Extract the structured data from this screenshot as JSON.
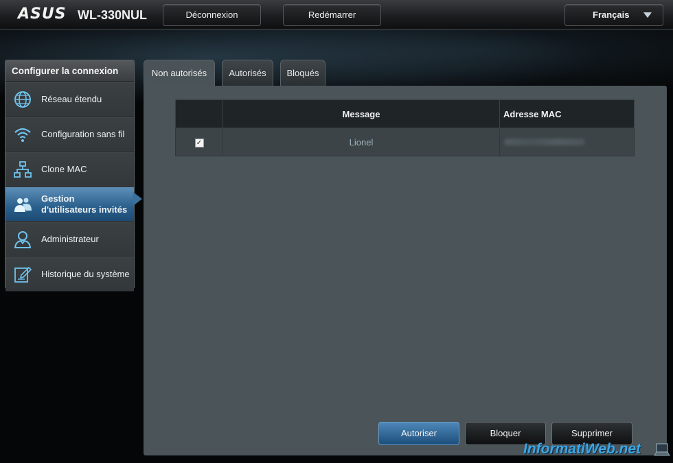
{
  "header": {
    "brand": "ASUS",
    "model": "WL-330NUL",
    "logout_label": "Déconnexion",
    "reboot_label": "Redémarrer",
    "language": "Français"
  },
  "sidebar": {
    "title": "Configurer la connexion",
    "items": [
      {
        "label": "Réseau étendu",
        "icon": "globe-icon"
      },
      {
        "label": "Configuration sans fil",
        "icon": "wifi-icon"
      },
      {
        "label": "Clone MAC",
        "icon": "network-icon"
      },
      {
        "label": "Gestion d'utilisateurs invités",
        "icon": "users-icon",
        "active": true
      },
      {
        "label": "Administrateur",
        "icon": "admin-icon"
      },
      {
        "label": "Historique du système",
        "icon": "log-icon"
      }
    ]
  },
  "tabs": [
    {
      "label": "Non autorisés",
      "active": true
    },
    {
      "label": "Autorisés"
    },
    {
      "label": "Bloqués"
    }
  ],
  "table": {
    "headers": [
      "",
      "Message",
      "Adresse MAC"
    ],
    "rows": [
      {
        "checked": true,
        "message": "Lionel",
        "mac": "(blurred)"
      }
    ]
  },
  "actions": {
    "authorize_label": "Autoriser",
    "block_label": "Bloquer",
    "delete_label": "Supprimer"
  },
  "watermark": "InformatiWeb.net",
  "colors": {
    "accent": "#2a5f8c",
    "panel": "#4b5458",
    "watermark": "#3aa6e6"
  }
}
